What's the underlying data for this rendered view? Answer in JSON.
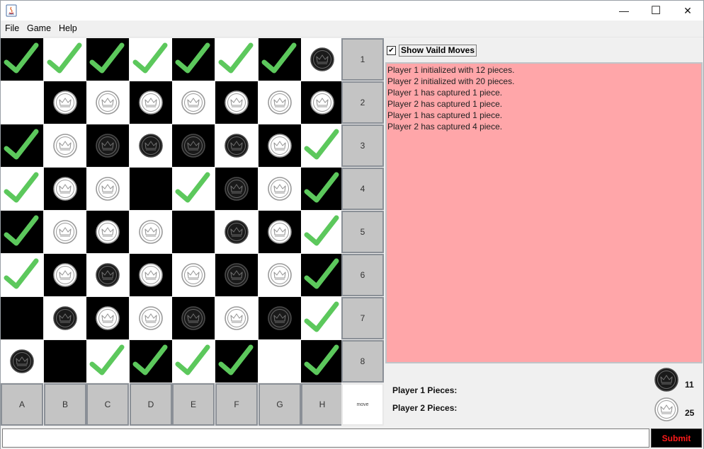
{
  "titlebar": {
    "app_icon": "java-app-icon",
    "minimize": "—",
    "maximize": "☐",
    "close": "✕"
  },
  "menu": {
    "items": [
      "File",
      "Game",
      "Help"
    ]
  },
  "board": {
    "columns": [
      "A",
      "B",
      "C",
      "D",
      "E",
      "F",
      "G",
      "H"
    ],
    "rows": [
      "1",
      "2",
      "3",
      "4",
      "5",
      "6",
      "7",
      "8"
    ],
    "corner_label": "move",
    "cells": [
      [
        "check",
        "check",
        "check",
        "check",
        "check",
        "check",
        "check",
        "black"
      ],
      [
        "",
        "white",
        "white",
        "white",
        "white",
        "white",
        "white",
        "white"
      ],
      [
        "check",
        "white",
        "black",
        "black",
        "black",
        "black",
        "white",
        "check"
      ],
      [
        "check",
        "white",
        "white",
        "",
        "check",
        "black",
        "white",
        "check"
      ],
      [
        "check",
        "white",
        "white",
        "white",
        "",
        "black",
        "white",
        "check"
      ],
      [
        "check",
        "white",
        "black",
        "white",
        "white",
        "black",
        "white",
        "check"
      ],
      [
        "",
        "black",
        "white",
        "white",
        "black",
        "white",
        "black",
        "check"
      ],
      [
        "black",
        "",
        "check",
        "check",
        "check",
        "check",
        "",
        "check"
      ]
    ],
    "colors": {
      "dark_square": "#000000",
      "light_square": "#ffffff",
      "check": "#5cc85c"
    }
  },
  "options": {
    "show_valid_moves_label": "Show Vaild Moves",
    "show_valid_moves_checked": true
  },
  "log": {
    "background": "#ffa6a9",
    "lines": [
      "Player 1 initialized with 12 pieces.",
      "Player 2 initialized with 20 pieces.",
      "Player 1 has captured 1 piece.",
      "Player 2 has captured 1 piece.",
      "Player 1 has captured 1 piece.",
      "Player 2 has captured 4 piece."
    ]
  },
  "status": {
    "player1_label": "Player 1 Pieces:",
    "player1_count": "11",
    "player2_label": "Player 2 Pieces:",
    "player2_count": "25"
  },
  "input": {
    "value": "",
    "placeholder": ""
  },
  "submit": {
    "label": "Submit",
    "text_color": "#ff1a1a"
  }
}
